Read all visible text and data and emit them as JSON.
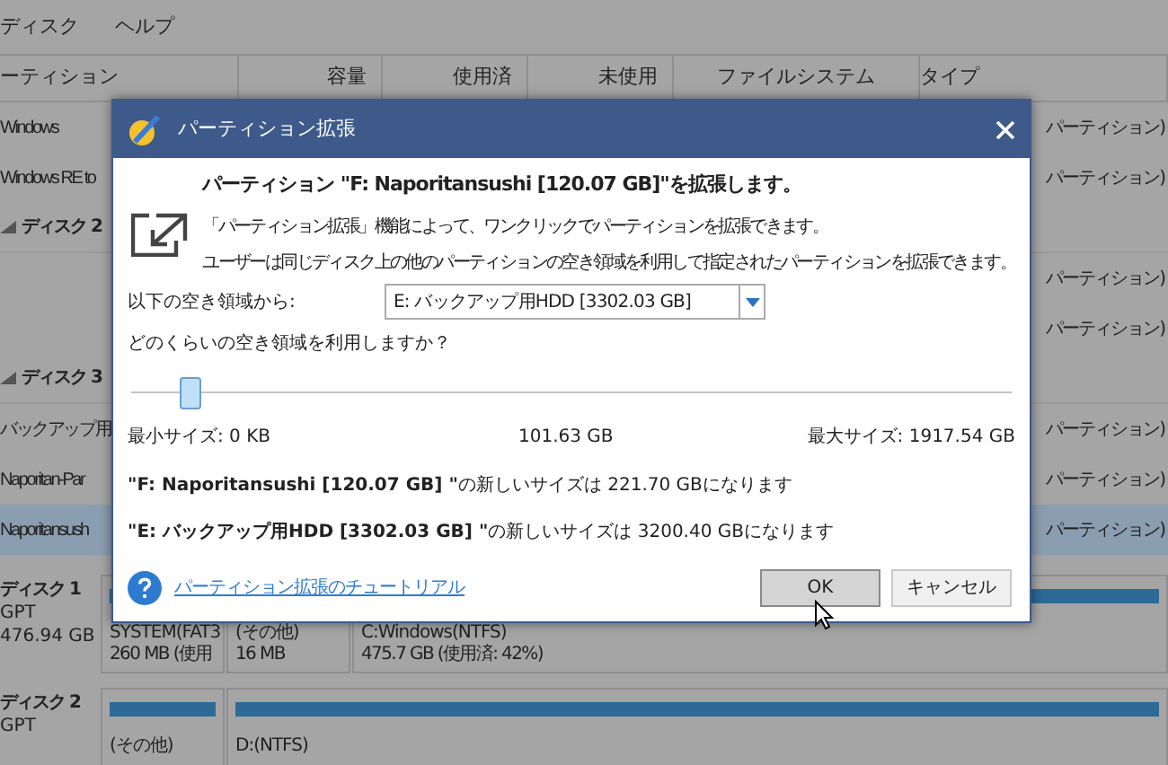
{
  "menu": [
    "ディスク",
    "ヘルプ"
  ],
  "table": {
    "columns": [
      "ーティション",
      "容量",
      "使用済",
      "未使用",
      "ファイルシステム",
      "タイプ"
    ],
    "rows": [
      {
        "kind": "partition",
        "name": "Windows",
        "type": "パーティション)",
        "selected": false
      },
      {
        "kind": "partition",
        "name": "Windows RE to",
        "type": "パーティション)",
        "selected": false
      },
      {
        "kind": "disk",
        "name": "ディスク 2"
      },
      {
        "kind": "partition",
        "type": "パーティション)",
        "selected": false
      },
      {
        "kind": "partition",
        "type": "パーティション)",
        "selected": false
      },
      {
        "kind": "disk",
        "name": "ディスク 3"
      },
      {
        "kind": "partition",
        "name": "バックアップ用",
        "type": "パーティション)",
        "selected": false
      },
      {
        "kind": "partition",
        "name": "Naporitan-Par",
        "type": "パーティション)",
        "selected": false
      },
      {
        "kind": "partition",
        "name": "Naporitansush",
        "type": "パーティション)",
        "selected": true
      }
    ]
  },
  "disk_map": [
    {
      "name": "ディスク 1",
      "scheme": "GPT",
      "size": "476.94 GB",
      "partitions": [
        {
          "label": "SYSTEM(FAT3",
          "detail": "260 MB (使用"
        },
        {
          "label": "(その他)",
          "detail": "16 MB"
        },
        {
          "label": "C:Windows(NTFS)",
          "detail": "475.7 GB (使用済: 42%)"
        }
      ]
    },
    {
      "name": "ディスク 2",
      "scheme": "GPT",
      "partitions": [
        {
          "label": "(その他)"
        },
        {
          "label": "D:(NTFS)"
        }
      ]
    }
  ],
  "dialog": {
    "title": "パーティション拡張",
    "heading": "パーティション \"F: Naporitansushi [120.07 GB]\"を拡張します。",
    "description": [
      "「パーティション拡張」機能によって、ワンクリックでパーティションを拡張できます。",
      "ユーザーは同じディスク上の他のパーティションの空き領域を利用して指定されたパーティションを拡張できます。"
    ],
    "source_label": "以下の空き領域から:",
    "source_value": "E: バックアップ用HDD [3302.03 GB]",
    "question": "どのくらいの空き領域を利用しますか？",
    "slider": {
      "level": 0.055
    },
    "min_label": "最小サイズ: 0 KB",
    "current": "101.63 GB",
    "max_label": "最大サイズ: 1917.54 GB",
    "results": [
      "**\"F: Naporitansushi [120.07 GB] \"**の新しいサイズは 221.70 GBになります",
      "**\"E: バックアップ用HDD [3302.03 GB] \"**の新しいサイズは 3200.40 GBになります"
    ],
    "help_link": "パーティション拡張のチュートリアル",
    "buttons": [
      {
        "label": "OK",
        "selected": true
      },
      {
        "label": "キャンセル",
        "selected": false
      }
    ]
  }
}
